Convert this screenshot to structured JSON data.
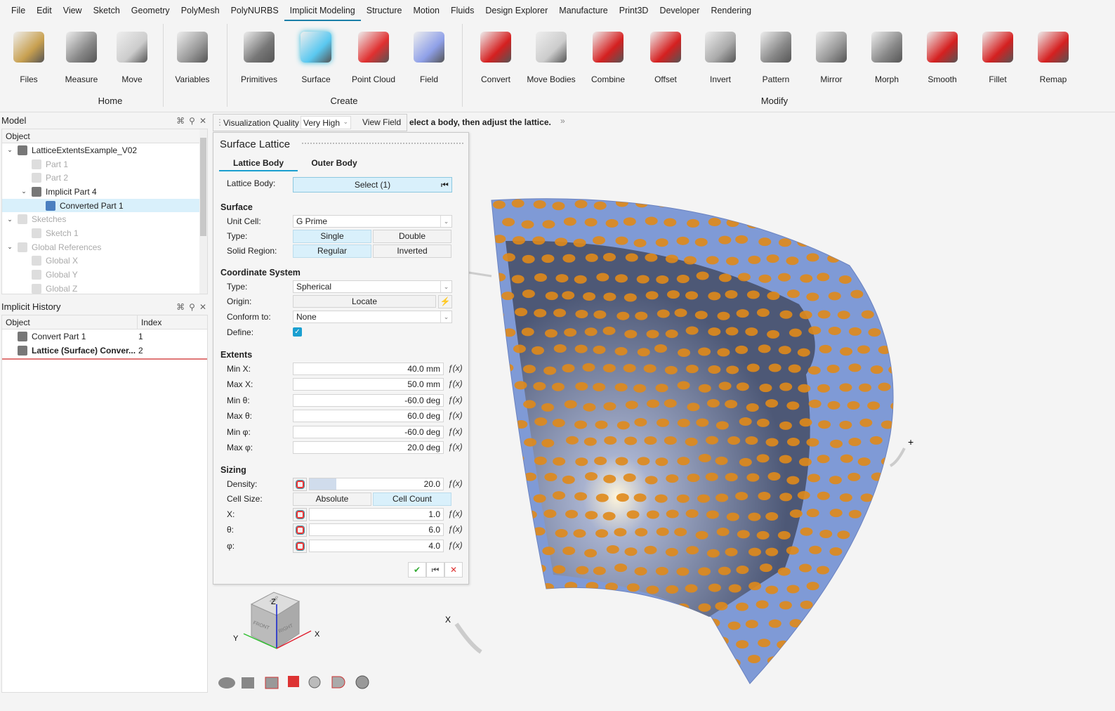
{
  "menu": [
    "File",
    "Edit",
    "View",
    "Sketch",
    "Geometry",
    "PolyMesh",
    "PolyNURBS",
    "Implicit Modeling",
    "Structure",
    "Motion",
    "Fluids",
    "Design Explorer",
    "Manufacture",
    "Print3D",
    "Developer",
    "Rendering"
  ],
  "menu_active": "Implicit Modeling",
  "ribbon": {
    "buttons": [
      {
        "label": "Files",
        "icon": "files-icon",
        "color": "#c8a050"
      },
      {
        "label": "Measure",
        "icon": "measure-icon",
        "color": "#888"
      },
      {
        "label": "Move",
        "icon": "move-icon",
        "color": "#ccc"
      },
      {
        "label": "Variables",
        "icon": "variables-icon",
        "color": "#999"
      },
      {
        "label": "Primitives",
        "icon": "primitives-icon",
        "color": "#777"
      },
      {
        "label": "Surface",
        "icon": "surface-lattice-icon",
        "color": "#5ac8f0"
      },
      {
        "label": "Point Cloud",
        "icon": "point-cloud-icon",
        "color": "#e03030"
      },
      {
        "label": "Field",
        "icon": "field-icon",
        "color": "#8fa0e8"
      },
      {
        "label": "Convert",
        "icon": "convert-icon",
        "color": "#d52020"
      },
      {
        "label": "Move Bodies",
        "icon": "move-bodies-icon",
        "color": "#ccc"
      },
      {
        "label": "Combine",
        "icon": "combine-icon",
        "color": "#d52020"
      },
      {
        "label": "Offset",
        "icon": "offset-icon",
        "color": "#d52020"
      },
      {
        "label": "Invert",
        "icon": "invert-icon",
        "color": "#aaa"
      },
      {
        "label": "Pattern",
        "icon": "pattern-icon",
        "color": "#888"
      },
      {
        "label": "Mirror",
        "icon": "mirror-icon",
        "color": "#999"
      },
      {
        "label": "Morph",
        "icon": "morph-icon",
        "color": "#888"
      },
      {
        "label": "Smooth",
        "icon": "smooth-icon",
        "color": "#d52020"
      },
      {
        "label": "Fillet",
        "icon": "fillet-icon",
        "color": "#d52020"
      },
      {
        "label": "Remap",
        "icon": "remap-icon",
        "color": "#d52020"
      }
    ],
    "groups": [
      "Home",
      "Create",
      "Modify"
    ]
  },
  "model_panel": {
    "title": "Model",
    "column": "Object",
    "items": [
      {
        "label": "LatticeExtentsExample_V02",
        "level": 0,
        "toggle": "expanded",
        "dim": false,
        "icon": "model-icon"
      },
      {
        "label": "Part 1",
        "level": 1,
        "toggle": "",
        "dim": true,
        "icon": "part-icon"
      },
      {
        "label": "Part 2",
        "level": 1,
        "toggle": "",
        "dim": true,
        "icon": "part-icon"
      },
      {
        "label": "Implicit Part 4",
        "level": 1,
        "toggle": "expanded",
        "dim": false,
        "icon": "implicit-part-icon"
      },
      {
        "label": "Converted Part 1",
        "level": 2,
        "toggle": "",
        "dim": false,
        "icon": "converted-part-icon",
        "selected": true
      },
      {
        "label": "Sketches",
        "level": 0,
        "toggle": "expanded",
        "dim": true,
        "icon": "folder-icon"
      },
      {
        "label": "Sketch 1",
        "level": 1,
        "toggle": "",
        "dim": true,
        "icon": "sketch-icon"
      },
      {
        "label": "Global References",
        "level": 0,
        "toggle": "expanded",
        "dim": true,
        "icon": "folder-icon"
      },
      {
        "label": "Global X",
        "level": 1,
        "toggle": "",
        "dim": true,
        "icon": "plane-icon"
      },
      {
        "label": "Global Y",
        "level": 1,
        "toggle": "",
        "dim": true,
        "icon": "plane-icon"
      },
      {
        "label": "Global Z",
        "level": 1,
        "toggle": "",
        "dim": true,
        "icon": "plane-icon"
      }
    ]
  },
  "history_panel": {
    "title": "Implicit History",
    "col_object": "Object",
    "col_index": "Index",
    "rows": [
      {
        "object": "Convert Part 1",
        "index": "1",
        "bold": false
      },
      {
        "object": "Lattice (Surface) Conver...",
        "index": "2",
        "bold": true
      }
    ]
  },
  "toolbar": {
    "vis_quality_label": "Visualization Quality",
    "vis_quality_value": "Very High",
    "view_field": "View Field",
    "hint": "elect a body, then adjust the lattice."
  },
  "dialog": {
    "title": "Surface Lattice",
    "tabs": [
      "Lattice Body",
      "Outer Body"
    ],
    "lattice_body_label": "Lattice Body:",
    "lattice_body_value": "Select (1)",
    "surface_heading": "Surface",
    "unit_cell_label": "Unit Cell:",
    "unit_cell_value": "G Prime",
    "type_label": "Type:",
    "type_options": [
      "Single",
      "Double"
    ],
    "type_selected": "Single",
    "solid_label": "Solid Region:",
    "solid_options": [
      "Regular",
      "Inverted"
    ],
    "solid_selected": "Regular",
    "cs_heading": "Coordinate System",
    "cs_type_label": "Type:",
    "cs_type_value": "Spherical",
    "origin_label": "Origin:",
    "origin_value": "Locate",
    "conform_label": "Conform to:",
    "conform_value": "None",
    "define_label": "Define:",
    "define_checked": true,
    "extents_heading": "Extents",
    "extents": [
      {
        "label": "Min X:",
        "value": "40.0 mm"
      },
      {
        "label": "Max X:",
        "value": "50.0 mm"
      },
      {
        "label": "Min θ:",
        "value": "-60.0 deg"
      },
      {
        "label": "Max θ:",
        "value": "60.0 deg"
      },
      {
        "label": "Min φ:",
        "value": "-60.0 deg"
      },
      {
        "label": "Max φ:",
        "value": "20.0 deg"
      }
    ],
    "sizing_heading": "Sizing",
    "density_label": "Density:",
    "density_value": "20.0",
    "density_fraction": 0.2,
    "cell_size_label": "Cell Size:",
    "cell_size_options": [
      "Absolute",
      "Cell Count"
    ],
    "cell_size_selected": "Cell Count",
    "counts": [
      {
        "label": "X:",
        "value": "1.0"
      },
      {
        "label": "θ:",
        "value": "6.0"
      },
      {
        "label": "φ:",
        "value": "4.0"
      }
    ],
    "fx": "ƒ(x)"
  },
  "viewcube": {
    "top": "TOP",
    "front": "FRONT",
    "right": "RIGHT",
    "x": "X",
    "y": "Y",
    "z": "Z"
  },
  "triad_x": "X",
  "colors": {
    "accent": "#1a7fa8",
    "selected": "#d9f0fb",
    "lattice_body": "#7f9ad6",
    "lattice_holes": "#e08a1a"
  }
}
